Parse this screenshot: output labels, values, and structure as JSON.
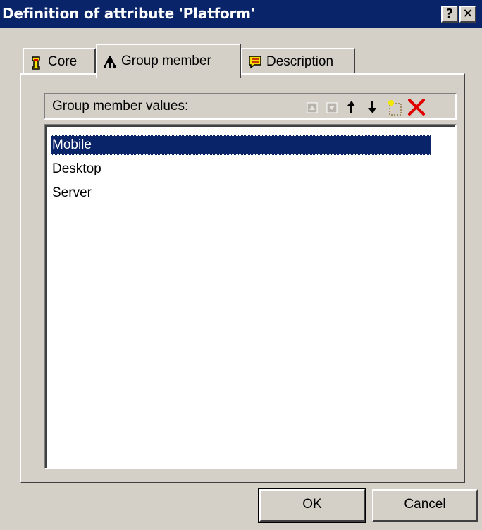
{
  "window": {
    "title": "Definition of attribute 'Platform'",
    "help_label": "?",
    "close_label": "✕"
  },
  "tabs": [
    {
      "label": "Core",
      "icon": "core-icon",
      "active": false
    },
    {
      "label": "Group member",
      "icon": "group-member-icon",
      "active": true
    },
    {
      "label": "Description",
      "icon": "description-icon",
      "active": false
    }
  ],
  "group_member": {
    "header_label": "Group member values:",
    "toolbar_icons": [
      "move-up-disabled-icon",
      "move-down-disabled-icon",
      "move-up-icon",
      "move-down-icon",
      "new-item-icon",
      "delete-icon"
    ],
    "values": [
      "Mobile",
      "Desktop",
      "Server"
    ],
    "selected_index": 0
  },
  "buttons": {
    "ok_label": "OK",
    "cancel_label": "Cancel"
  },
  "colors": {
    "titlebar": "#0a246a",
    "selection": "#0a246a",
    "face": "#d4d0c8",
    "delete_red": "#e00000"
  }
}
